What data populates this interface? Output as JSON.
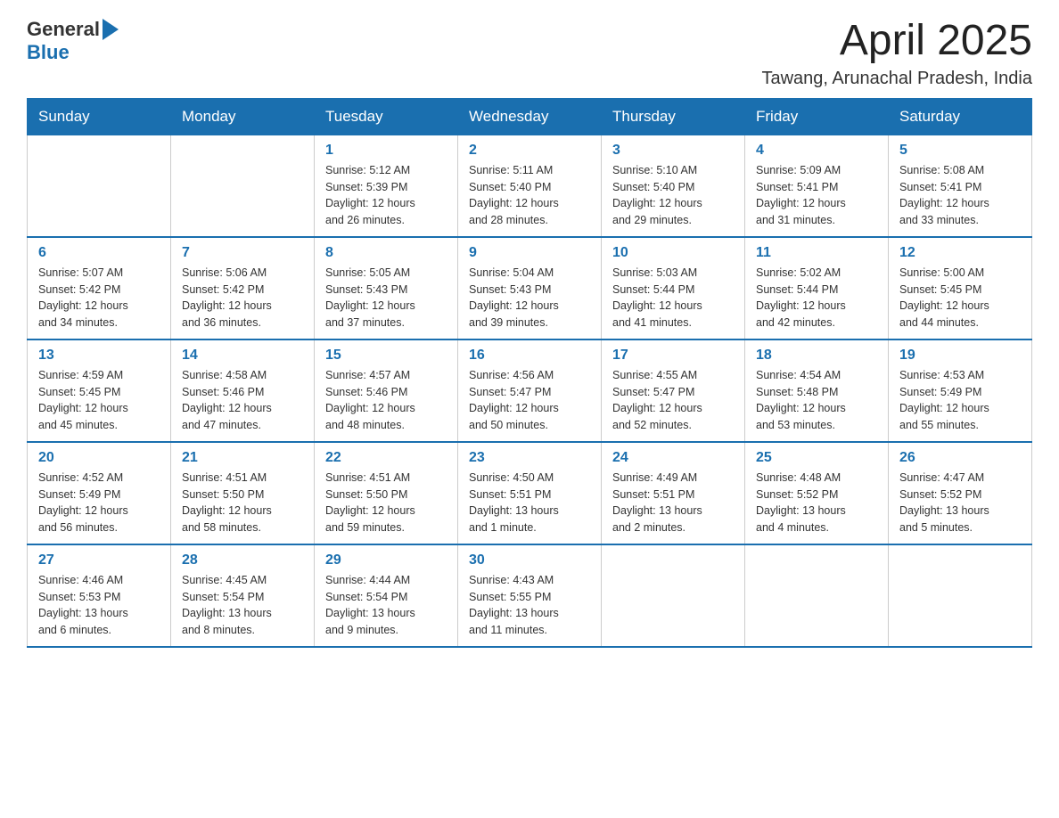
{
  "header": {
    "logo_general": "General",
    "logo_blue": "Blue",
    "month_year": "April 2025",
    "location": "Tawang, Arunachal Pradesh, India"
  },
  "days_of_week": [
    "Sunday",
    "Monday",
    "Tuesday",
    "Wednesday",
    "Thursday",
    "Friday",
    "Saturday"
  ],
  "weeks": [
    [
      {
        "day": "",
        "info": ""
      },
      {
        "day": "",
        "info": ""
      },
      {
        "day": "1",
        "info": "Sunrise: 5:12 AM\nSunset: 5:39 PM\nDaylight: 12 hours\nand 26 minutes."
      },
      {
        "day": "2",
        "info": "Sunrise: 5:11 AM\nSunset: 5:40 PM\nDaylight: 12 hours\nand 28 minutes."
      },
      {
        "day": "3",
        "info": "Sunrise: 5:10 AM\nSunset: 5:40 PM\nDaylight: 12 hours\nand 29 minutes."
      },
      {
        "day": "4",
        "info": "Sunrise: 5:09 AM\nSunset: 5:41 PM\nDaylight: 12 hours\nand 31 minutes."
      },
      {
        "day": "5",
        "info": "Sunrise: 5:08 AM\nSunset: 5:41 PM\nDaylight: 12 hours\nand 33 minutes."
      }
    ],
    [
      {
        "day": "6",
        "info": "Sunrise: 5:07 AM\nSunset: 5:42 PM\nDaylight: 12 hours\nand 34 minutes."
      },
      {
        "day": "7",
        "info": "Sunrise: 5:06 AM\nSunset: 5:42 PM\nDaylight: 12 hours\nand 36 minutes."
      },
      {
        "day": "8",
        "info": "Sunrise: 5:05 AM\nSunset: 5:43 PM\nDaylight: 12 hours\nand 37 minutes."
      },
      {
        "day": "9",
        "info": "Sunrise: 5:04 AM\nSunset: 5:43 PM\nDaylight: 12 hours\nand 39 minutes."
      },
      {
        "day": "10",
        "info": "Sunrise: 5:03 AM\nSunset: 5:44 PM\nDaylight: 12 hours\nand 41 minutes."
      },
      {
        "day": "11",
        "info": "Sunrise: 5:02 AM\nSunset: 5:44 PM\nDaylight: 12 hours\nand 42 minutes."
      },
      {
        "day": "12",
        "info": "Sunrise: 5:00 AM\nSunset: 5:45 PM\nDaylight: 12 hours\nand 44 minutes."
      }
    ],
    [
      {
        "day": "13",
        "info": "Sunrise: 4:59 AM\nSunset: 5:45 PM\nDaylight: 12 hours\nand 45 minutes."
      },
      {
        "day": "14",
        "info": "Sunrise: 4:58 AM\nSunset: 5:46 PM\nDaylight: 12 hours\nand 47 minutes."
      },
      {
        "day": "15",
        "info": "Sunrise: 4:57 AM\nSunset: 5:46 PM\nDaylight: 12 hours\nand 48 minutes."
      },
      {
        "day": "16",
        "info": "Sunrise: 4:56 AM\nSunset: 5:47 PM\nDaylight: 12 hours\nand 50 minutes."
      },
      {
        "day": "17",
        "info": "Sunrise: 4:55 AM\nSunset: 5:47 PM\nDaylight: 12 hours\nand 52 minutes."
      },
      {
        "day": "18",
        "info": "Sunrise: 4:54 AM\nSunset: 5:48 PM\nDaylight: 12 hours\nand 53 minutes."
      },
      {
        "day": "19",
        "info": "Sunrise: 4:53 AM\nSunset: 5:49 PM\nDaylight: 12 hours\nand 55 minutes."
      }
    ],
    [
      {
        "day": "20",
        "info": "Sunrise: 4:52 AM\nSunset: 5:49 PM\nDaylight: 12 hours\nand 56 minutes."
      },
      {
        "day": "21",
        "info": "Sunrise: 4:51 AM\nSunset: 5:50 PM\nDaylight: 12 hours\nand 58 minutes."
      },
      {
        "day": "22",
        "info": "Sunrise: 4:51 AM\nSunset: 5:50 PM\nDaylight: 12 hours\nand 59 minutes."
      },
      {
        "day": "23",
        "info": "Sunrise: 4:50 AM\nSunset: 5:51 PM\nDaylight: 13 hours\nand 1 minute."
      },
      {
        "day": "24",
        "info": "Sunrise: 4:49 AM\nSunset: 5:51 PM\nDaylight: 13 hours\nand 2 minutes."
      },
      {
        "day": "25",
        "info": "Sunrise: 4:48 AM\nSunset: 5:52 PM\nDaylight: 13 hours\nand 4 minutes."
      },
      {
        "day": "26",
        "info": "Sunrise: 4:47 AM\nSunset: 5:52 PM\nDaylight: 13 hours\nand 5 minutes."
      }
    ],
    [
      {
        "day": "27",
        "info": "Sunrise: 4:46 AM\nSunset: 5:53 PM\nDaylight: 13 hours\nand 6 minutes."
      },
      {
        "day": "28",
        "info": "Sunrise: 4:45 AM\nSunset: 5:54 PM\nDaylight: 13 hours\nand 8 minutes."
      },
      {
        "day": "29",
        "info": "Sunrise: 4:44 AM\nSunset: 5:54 PM\nDaylight: 13 hours\nand 9 minutes."
      },
      {
        "day": "30",
        "info": "Sunrise: 4:43 AM\nSunset: 5:55 PM\nDaylight: 13 hours\nand 11 minutes."
      },
      {
        "day": "",
        "info": ""
      },
      {
        "day": "",
        "info": ""
      },
      {
        "day": "",
        "info": ""
      }
    ]
  ]
}
